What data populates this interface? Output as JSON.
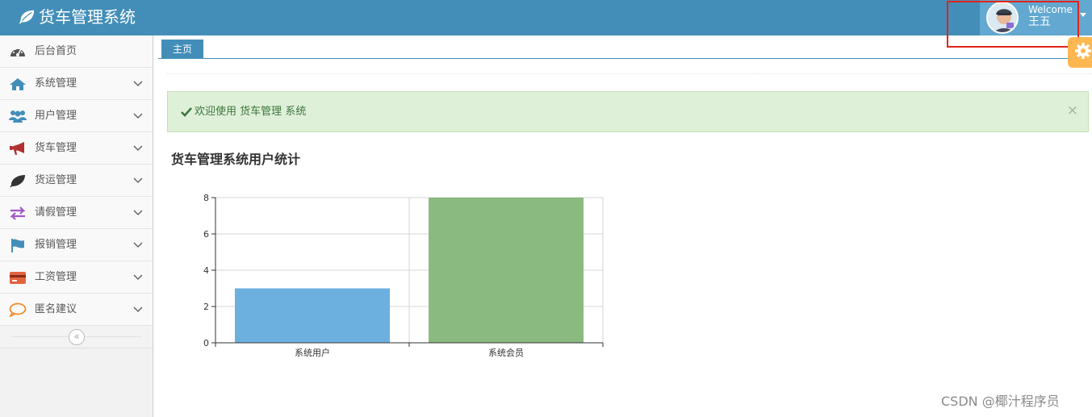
{
  "app": {
    "title": "货车管理系统",
    "brand_icon": "leaf-icon",
    "colors": {
      "navbar": "#438eb9",
      "user_box": "#62a8d1",
      "tab": "#438eb9",
      "alert_bg": "#dff0d8",
      "alert_text": "#3c763d",
      "settings": "#ffb752"
    }
  },
  "user": {
    "welcome": "Welcome",
    "name": "王五"
  },
  "sidebar": {
    "items": [
      {
        "label": "后台首页",
        "icon": "dashboard-icon",
        "has_submenu": false
      },
      {
        "label": "系统管理",
        "icon": "home-icon",
        "has_submenu": true
      },
      {
        "label": "用户管理",
        "icon": "users-icon",
        "has_submenu": true
      },
      {
        "label": "货车管理",
        "icon": "bullhorn-icon",
        "has_submenu": true
      },
      {
        "label": "货运管理",
        "icon": "leaf-icon",
        "has_submenu": true
      },
      {
        "label": "请假管理",
        "icon": "exchange-icon",
        "has_submenu": true
      },
      {
        "label": "报销管理",
        "icon": "flag-icon",
        "has_submenu": true
      },
      {
        "label": "工资管理",
        "icon": "credit-card-icon",
        "has_submenu": true
      },
      {
        "label": "匿名建议",
        "icon": "comment-icon",
        "has_submenu": true
      }
    ],
    "collapse_icon": "double-angle-left-icon"
  },
  "tabs": [
    {
      "label": "主页",
      "active": true
    }
  ],
  "alert": {
    "prefix": "欢迎使用",
    "system": "货车管理",
    "suffix": "系统",
    "close": "×"
  },
  "section": {
    "title": "货车管理系统用户统计"
  },
  "chart_data": {
    "type": "bar",
    "categories": [
      "系统用户",
      "系统会员"
    ],
    "values": [
      3,
      8
    ],
    "colors": [
      "#6cb0e0",
      "#8aba80"
    ],
    "title": "",
    "xlabel": "",
    "ylabel": "",
    "ylim": [
      0,
      8
    ],
    "yticks": [
      0,
      2,
      4,
      6,
      8
    ],
    "grid": true
  },
  "watermark": "CSDN @椰汁程序员"
}
